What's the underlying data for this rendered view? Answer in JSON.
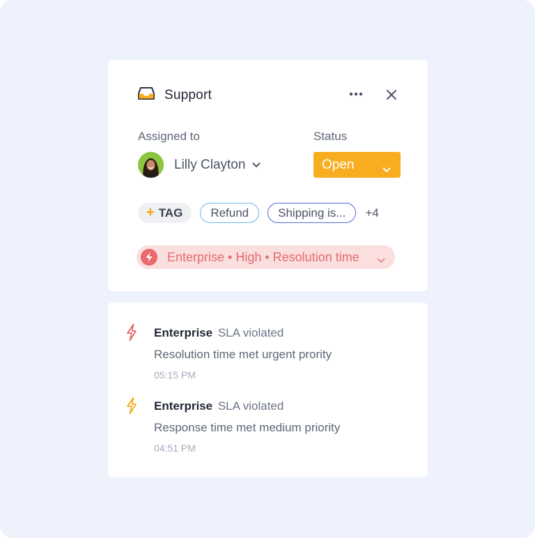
{
  "panel": {
    "title": "Support",
    "assigned_label": "Assigned to",
    "assignee_name": "Lilly Clayton",
    "status_label": "Status",
    "status_value": "Open"
  },
  "tags": {
    "add_label": "TAG",
    "items": [
      "Refund",
      "Shipping is..."
    ],
    "more": "+4"
  },
  "sla": {
    "label": "Enterprise • High • Resolution time"
  },
  "events": [
    {
      "strong": "Enterprise",
      "rest": "SLA violated",
      "desc": "Resolution time met urgent prority",
      "time": "05:15 PM",
      "icon": "lightning-icon",
      "color": "#e0575b"
    },
    {
      "strong": "Enterprise",
      "rest": "SLA violated",
      "desc": "Response time met medium priority",
      "time": "04:51 PM",
      "icon": "lightning-icon",
      "color": "#f5a20a"
    }
  ],
  "colors": {
    "accent": "#f7ad1e",
    "sla_bg": "#fbdede",
    "sla_text": "#e46b6f",
    "background": "#eef2fd"
  }
}
